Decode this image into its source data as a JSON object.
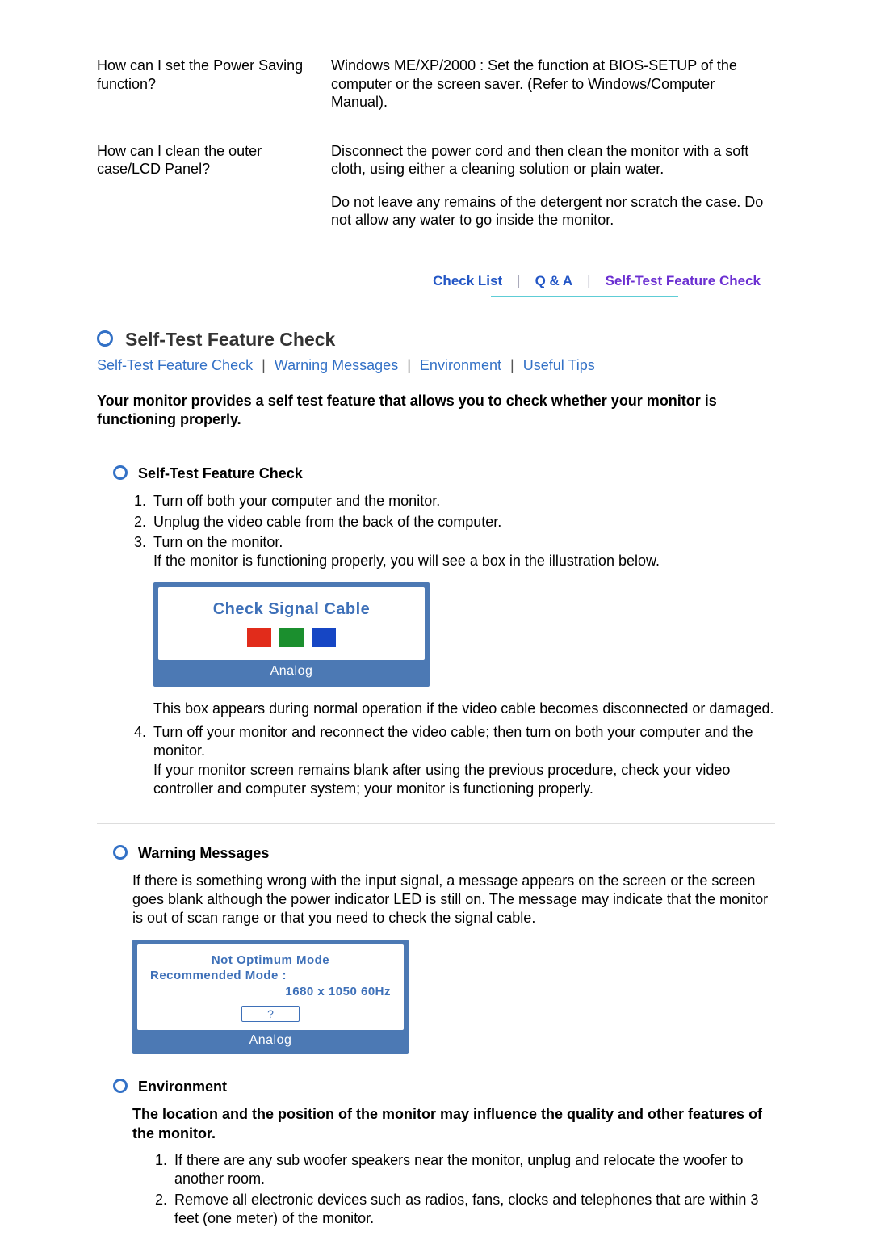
{
  "qa": [
    {
      "q": "How can I set the Power Saving function?",
      "a": [
        "Windows ME/XP/2000 : Set the function at BIOS-SETUP of the computer or the screen saver. (Refer to Windows/Computer Manual)."
      ]
    },
    {
      "q": "How can I clean the outer case/LCD Panel?",
      "a": [
        "Disconnect the power cord and then clean the monitor with a soft cloth, using either a cleaning solution or plain water.",
        "Do not leave any remains of the detergent nor scratch the case. Do not allow any water to go inside the monitor."
      ]
    }
  ],
  "tabs": {
    "items": [
      "Check List",
      "Q & A",
      "Self-Test Feature Check"
    ],
    "active_index": 2
  },
  "section": {
    "title": "Self-Test Feature Check",
    "subnav": [
      "Self-Test Feature Check",
      "Warning Messages",
      "Environment",
      "Useful Tips"
    ],
    "intro": "Your monitor provides a self test feature that allows you to check whether your monitor is functioning properly."
  },
  "selftest": {
    "heading": "Self-Test Feature Check",
    "steps": [
      "Turn off both your computer and the monitor.",
      "Unplug the video cable from the back of the computer.",
      "Turn on the monitor."
    ],
    "step3_extra": "If the monitor is functioning properly, you will see a box in the illustration below.",
    "osd1": {
      "text": "Check Signal Cable",
      "footer": "Analog"
    },
    "after_box": "This box appears during normal operation if the video cable becomes disconnected or damaged.",
    "step4": "Turn off your monitor and reconnect the video cable; then turn on both your computer and the monitor.",
    "step4_extra": "If your monitor screen remains blank after using the previous procedure, check your video controller and computer system; your monitor is functioning properly."
  },
  "warning": {
    "heading": "Warning Messages",
    "text": "If there is something wrong with the input signal, a message appears on the screen or the screen goes blank although the power indicator LED is still on. The message may indicate that the monitor is out of scan range or that you need to check the signal cable.",
    "osd2": {
      "line1": "Not Optimum Mode",
      "line2": "Recommended Mode :",
      "line3": "1680 x 1050   60Hz",
      "help": "?",
      "footer": "Analog"
    }
  },
  "environment": {
    "heading": "Environment",
    "bold_text": "The location and the position of the monitor may influence the quality and other features of the monitor.",
    "items": [
      "If there are any sub woofer speakers near the monitor, unplug and relocate the woofer to another room.",
      "Remove all electronic devices such as radios, fans, clocks and telephones that are within 3 feet (one meter) of the monitor."
    ]
  }
}
